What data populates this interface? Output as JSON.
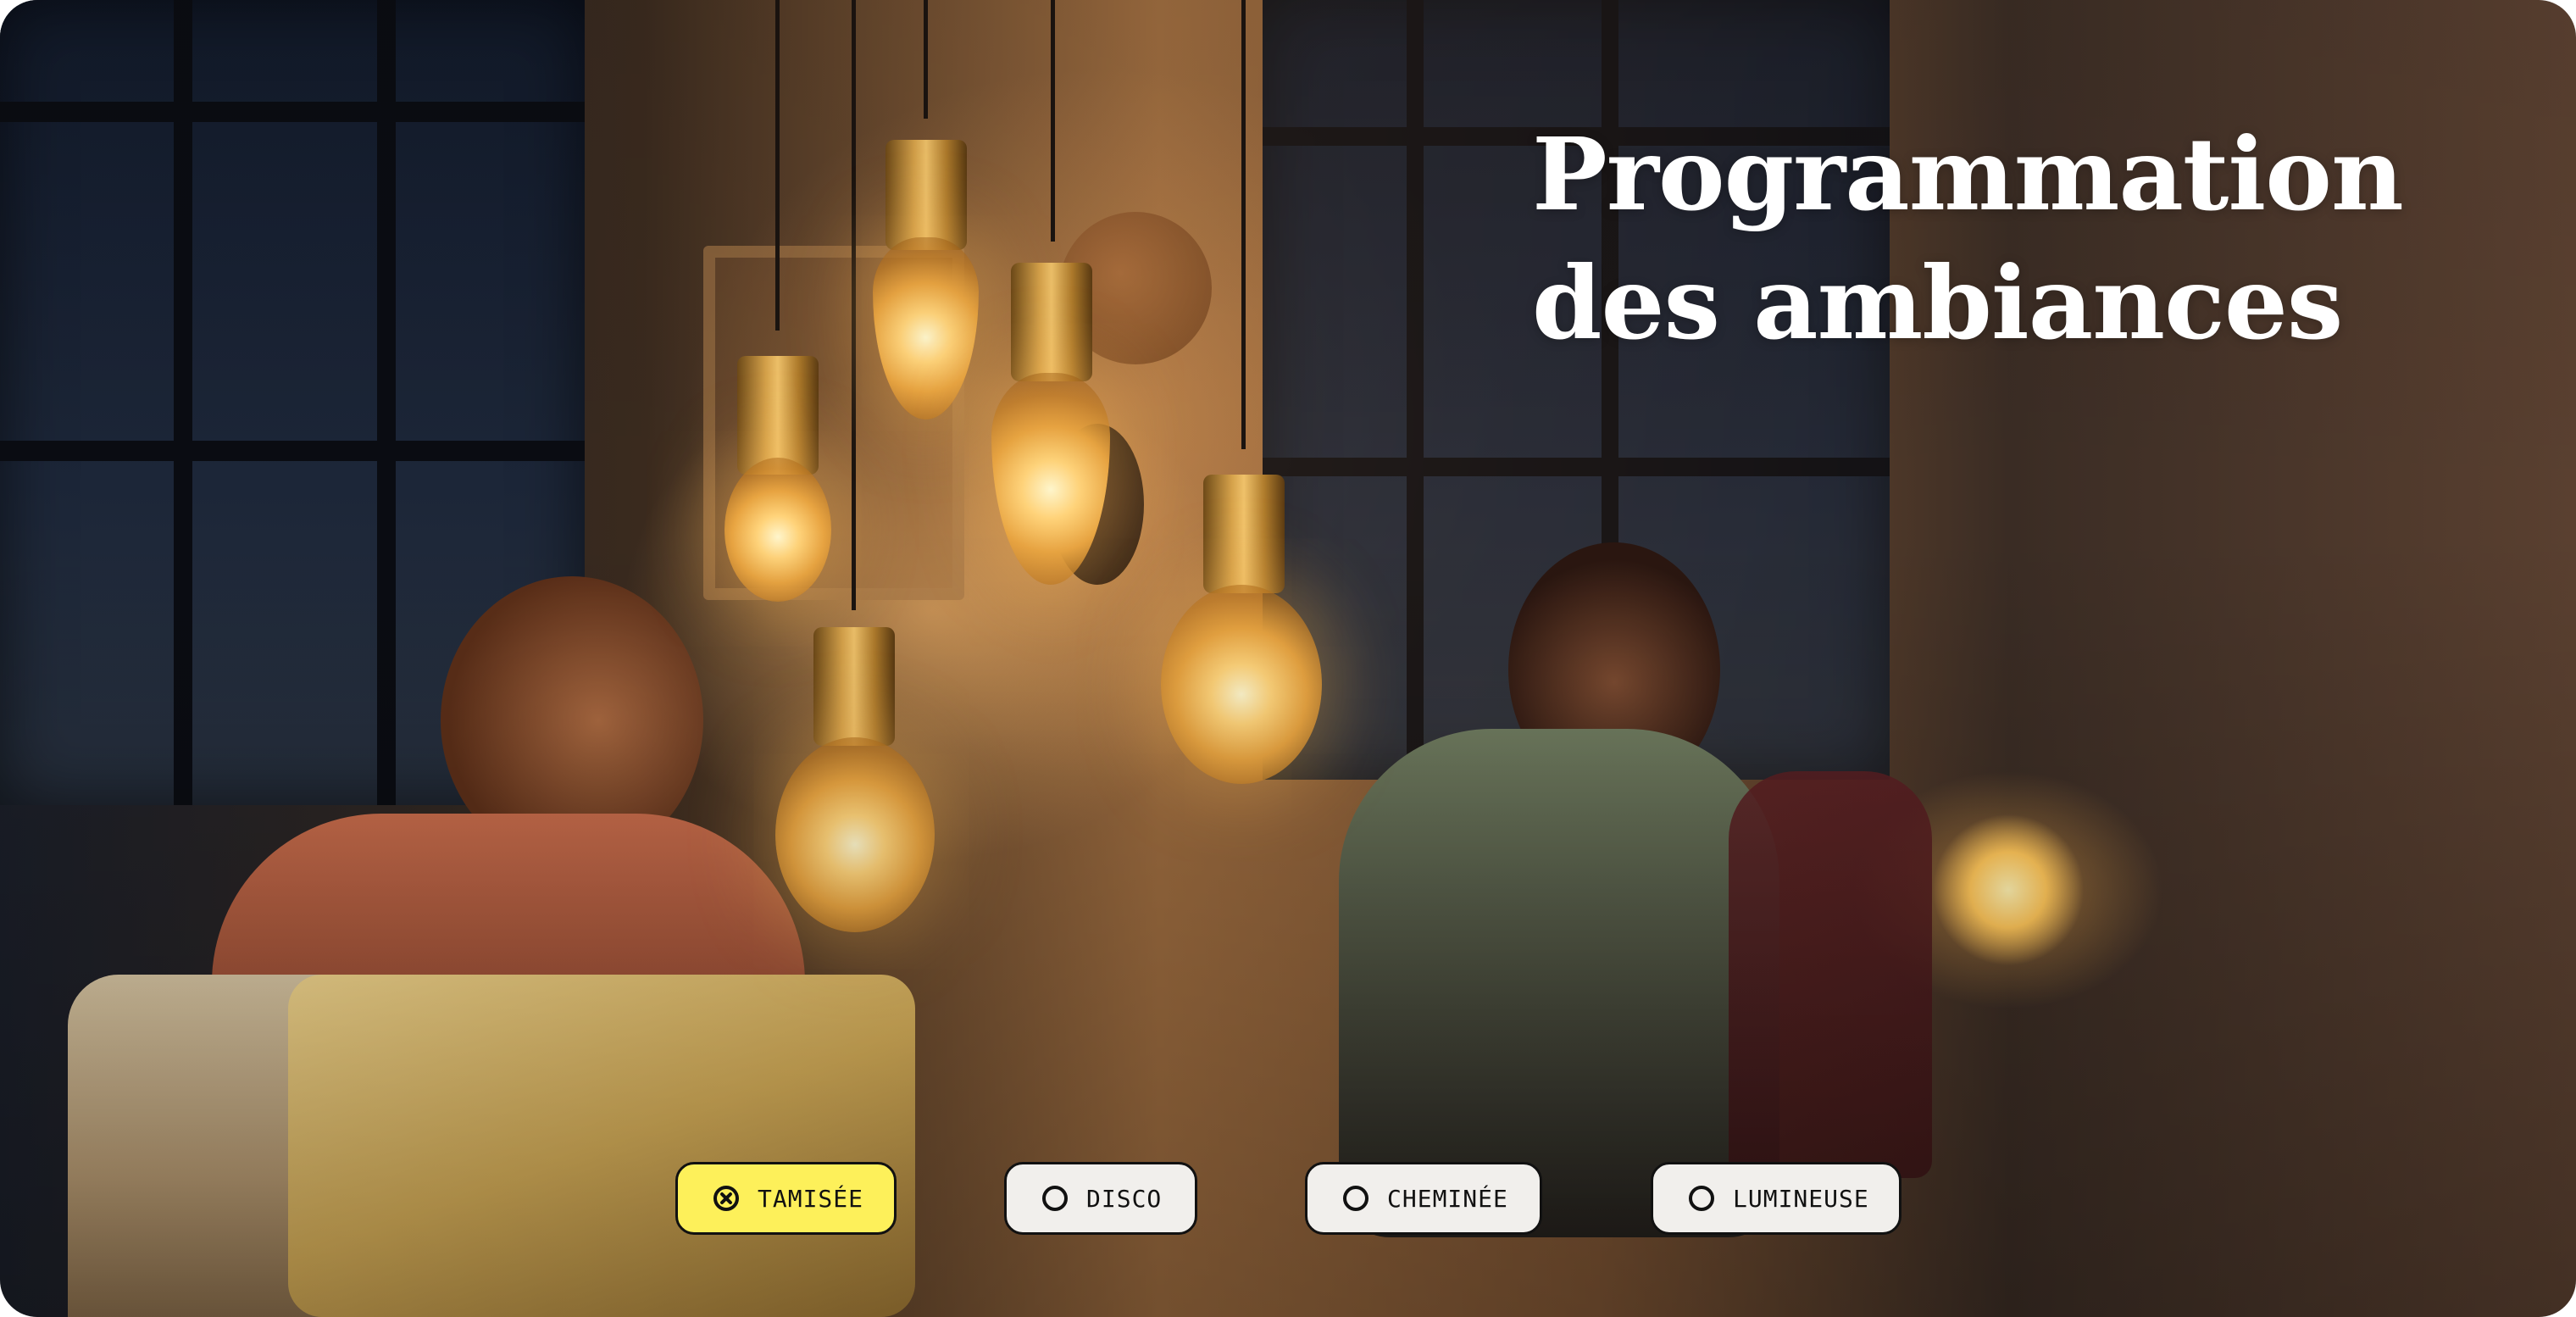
{
  "hero": {
    "title_line_1": "Programmation",
    "title_line_2": "des ambiances",
    "image_description_icon": "living-room-pendant-bulbs-photo"
  },
  "modes": {
    "selected": "tamisee",
    "items": [
      {
        "id": "tamisee",
        "label": "TAMISÉE",
        "selected": true
      },
      {
        "id": "disco",
        "label": "DISCO",
        "selected": false
      },
      {
        "id": "cheminee",
        "label": "CHEMINÉE",
        "selected": false
      },
      {
        "id": "lumineuse",
        "label": "LUMINEUSE",
        "selected": false
      }
    ]
  },
  "colors": {
    "active_button": "#fdf05a",
    "inactive_button": "#f1efec",
    "border": "#111111",
    "title_text": "#ffffff"
  }
}
